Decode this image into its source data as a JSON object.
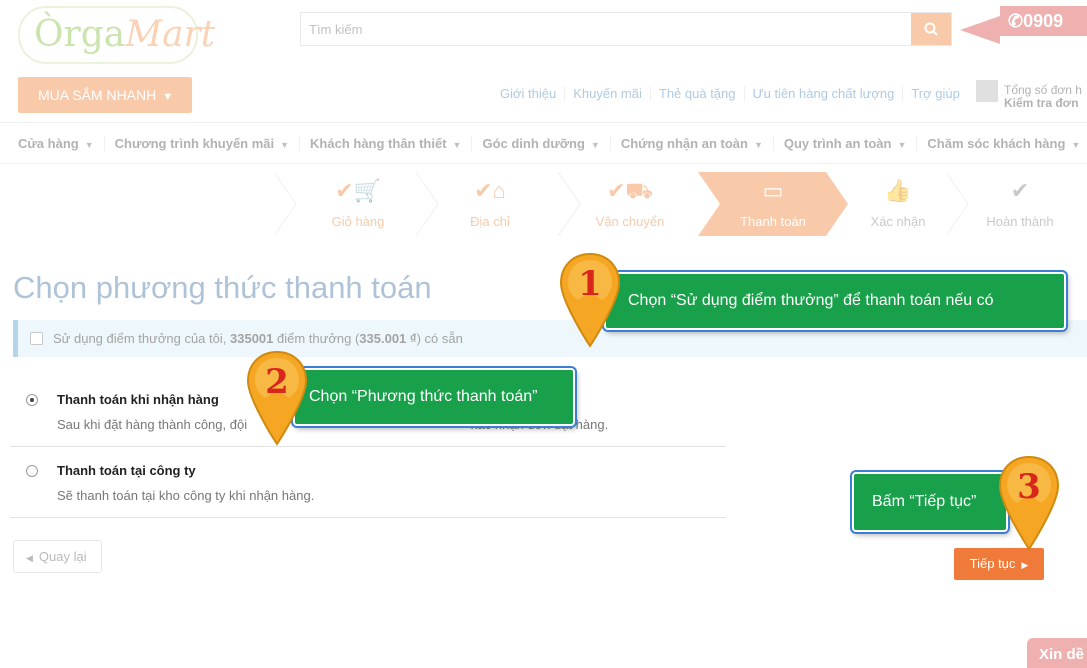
{
  "header": {
    "logo_prefix": "Òrga",
    "logo_suffix": "Mart",
    "search_placeholder": "Tìm kiếm",
    "phone": "0909",
    "quick_shop": "MUA SẮM NHANH",
    "top_links": [
      "Giới thiệu",
      "Khuyến mãi",
      "Thẻ quà tặng",
      "Ưu tiên hàng chất lượng",
      "Trợ giúp"
    ],
    "cart_line1": "Tổng số đơn h",
    "cart_line2": "Kiểm tra đơn"
  },
  "nav": {
    "items": [
      "Cửa hàng",
      "Chương trình khuyến mãi",
      "Khách hàng thân thiết",
      "Góc dinh dưỡng",
      "Chứng nhận an toàn",
      "Quy trình an toàn",
      "Chăm sóc khách hàng"
    ]
  },
  "steps": [
    {
      "label": "Giỏ hàng",
      "state": "done",
      "icon": "cart-icon"
    },
    {
      "label": "Địa chỉ",
      "state": "done",
      "icon": "home-icon"
    },
    {
      "label": "Vận chuyển",
      "state": "done",
      "icon": "truck-icon"
    },
    {
      "label": "Thanh toán",
      "state": "active",
      "icon": "credit-card-icon"
    },
    {
      "label": "Xác nhận",
      "state": "pending",
      "icon": "thumbs-up-icon"
    },
    {
      "label": "Hoàn thành",
      "state": "pending",
      "icon": "check-circle-icon"
    }
  ],
  "page_title": "Chọn phương thức thanh toán",
  "points": {
    "prefix": "Sử dụng điểm thưởng của tôi,",
    "points": "335001",
    "middle": "điểm thưởng (",
    "amount": "335.001 ₫",
    "suffix": ") có sẵn"
  },
  "methods": [
    {
      "title": "Thanh toán khi nhận hàng",
      "desc": "Sau khi đặt hàng thành công, đội                                                              xác nhận đơn đặt hàng.",
      "selected": true
    },
    {
      "title": "Thanh toán tại công ty",
      "desc": "Sẽ thanh toán tại kho công ty khi nhận hàng.",
      "selected": false
    }
  ],
  "back_label": "Quay lại",
  "continue_label": "Tiếp tục",
  "chat_label": "Xin dề",
  "callouts": [
    {
      "number": "1",
      "text": "Chọn “Sử dụng điểm thưởng” để thanh toán nếu có"
    },
    {
      "number": "2",
      "text": "Chọn “Phương thức thanh toán”"
    },
    {
      "number": "3",
      "text": "Bấm “Tiếp tục”"
    }
  ],
  "colors": {
    "accent": "#f28a44",
    "callout": "#18a04a",
    "pin": "#f5a623",
    "info_bar": "#d9edf7"
  }
}
